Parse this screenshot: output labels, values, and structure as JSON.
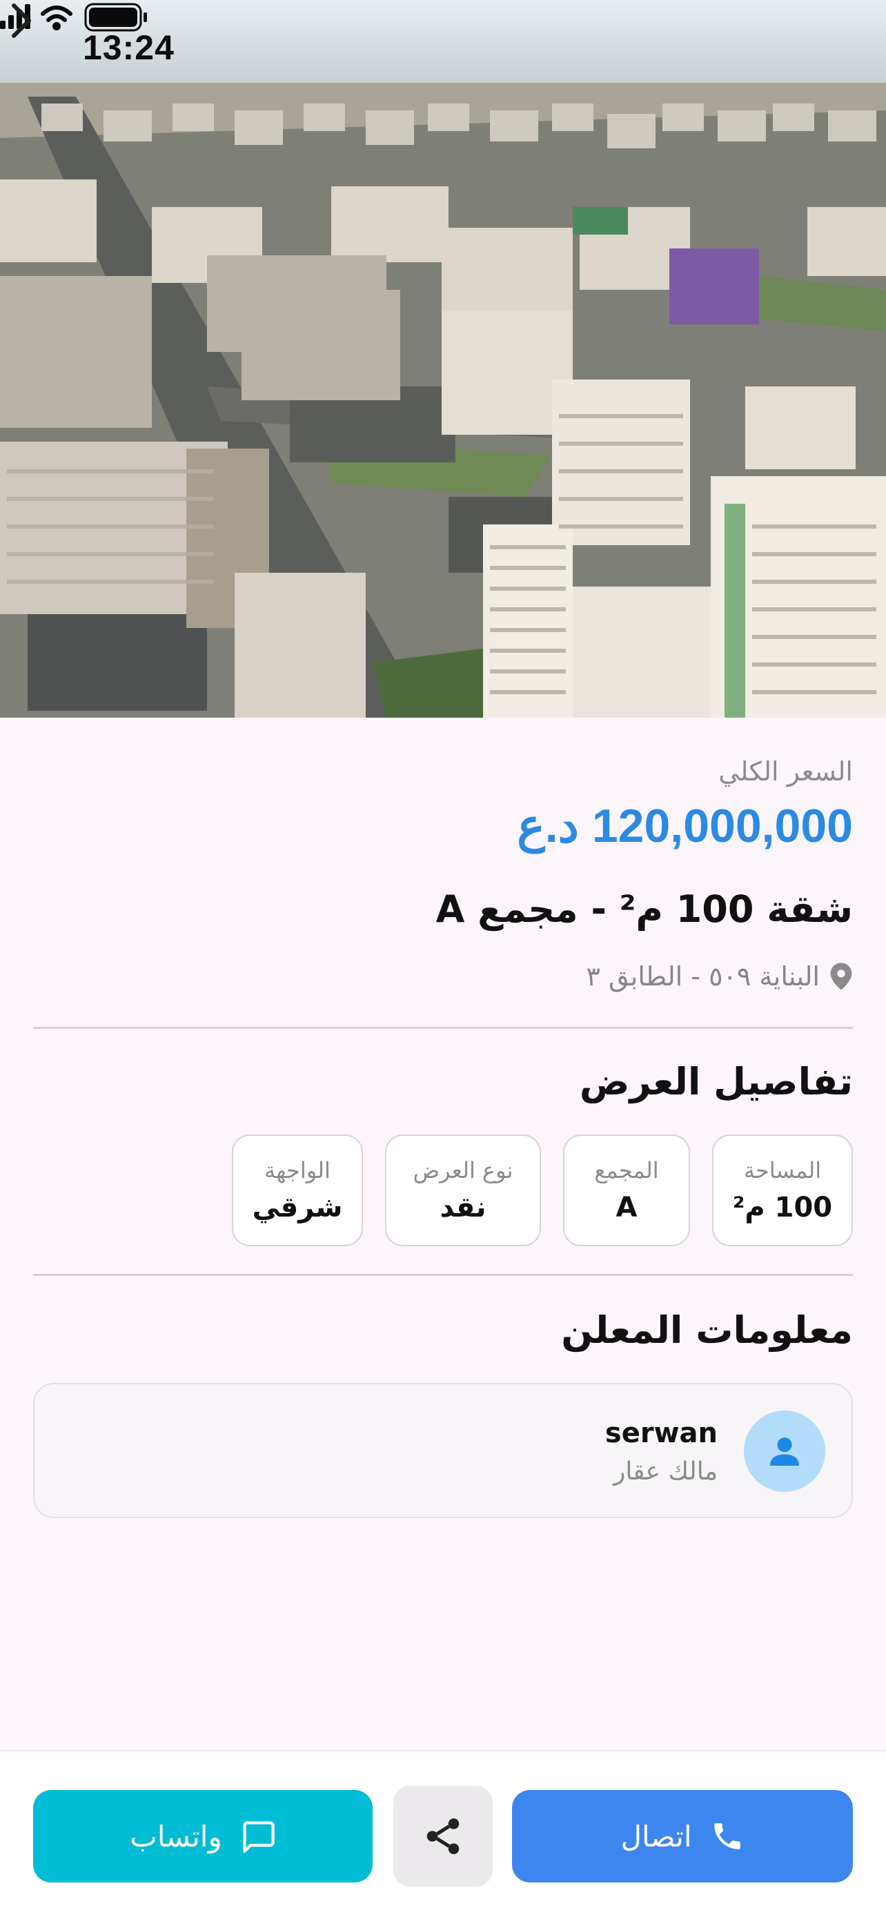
{
  "status_bar": {
    "time": "13:24",
    "icons": [
      "signal-icon",
      "wifi-icon",
      "battery-icon"
    ]
  },
  "gallery": {
    "next_icon": "chevron-right-icon"
  },
  "listing": {
    "price_label": "السعر الكلي",
    "price": "120,000,000 د.ع",
    "title": "شقة 100 م² - مجمع A",
    "location": "البناية ٥٠٩ - الطابق ٣",
    "location_icon": "location-pin-icon"
  },
  "offer_details": {
    "section_title": "تفاصيل العرض",
    "items": [
      {
        "label": "المساحة",
        "value": "100 م²"
      },
      {
        "label": "المجمع",
        "value": "A"
      },
      {
        "label": "نوع العرض",
        "value": "نقد"
      },
      {
        "label": "الواجهة",
        "value": "شرقي"
      }
    ]
  },
  "advertiser": {
    "section_title": "معلومات المعلن",
    "name": "serwan",
    "role": "مالك عقار",
    "avatar_icon": "person-icon"
  },
  "actions": {
    "call_label": "اتصال",
    "whatsapp_label": "واتساب",
    "call_icon": "phone-icon",
    "share_icon": "share-icon",
    "whatsapp_icon": "chat-icon"
  },
  "colors": {
    "background": "#fdf5fc",
    "price": "#2b8ae3",
    "call_button": "#3d86ef",
    "whatsapp_button": "#00bcd4",
    "share_button": "#ebe9eb",
    "avatar_bg": "#b3dcfa"
  }
}
